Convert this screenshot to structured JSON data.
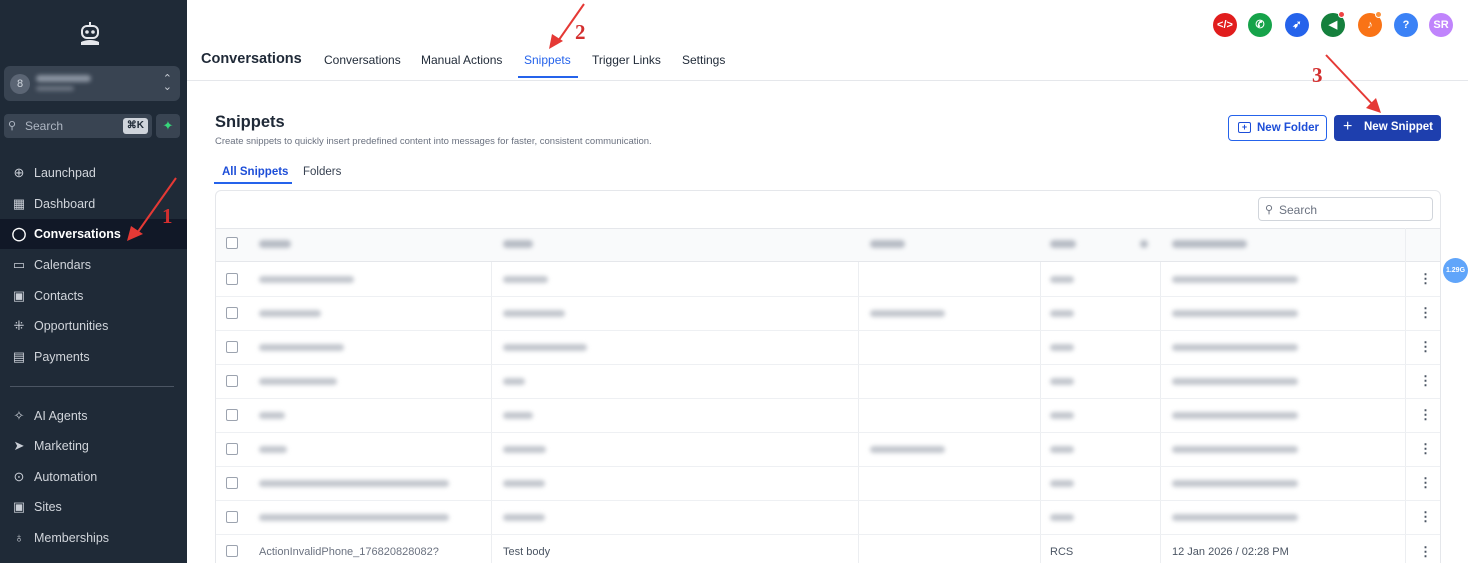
{
  "sidebar": {
    "search_placeholder": "Search",
    "search_shortcut": "⌘K",
    "account_avatar": "8",
    "items": [
      {
        "label": "Launchpad",
        "icon": "launchpad-icon",
        "glyph": "⊕",
        "active": false
      },
      {
        "label": "Dashboard",
        "icon": "dashboard-icon",
        "glyph": "▦",
        "active": false
      },
      {
        "label": "Conversations",
        "icon": "chat-bubble-icon",
        "glyph": "◯",
        "active": true
      },
      {
        "label": "Calendars",
        "icon": "calendar-icon",
        "glyph": "▭",
        "active": false
      },
      {
        "label": "Contacts",
        "icon": "contacts-icon",
        "glyph": "▣",
        "active": false
      },
      {
        "label": "Opportunities",
        "icon": "opportunities-icon",
        "glyph": "⁜",
        "active": false
      },
      {
        "label": "Payments",
        "icon": "payments-icon",
        "glyph": "▤",
        "active": false
      },
      {
        "label": "AI Agents",
        "icon": "ai-agents-icon",
        "glyph": "✧",
        "active": false
      },
      {
        "label": "Marketing",
        "icon": "marketing-icon",
        "glyph": "➤",
        "active": false
      },
      {
        "label": "Automation",
        "icon": "automation-icon",
        "glyph": "⊙",
        "active": false
      },
      {
        "label": "Sites",
        "icon": "sites-icon",
        "glyph": "▣",
        "active": false
      },
      {
        "label": "Memberships",
        "icon": "memberships-icon",
        "glyph": "♁",
        "active": false
      }
    ]
  },
  "header": {
    "title": "Conversations",
    "tabs": [
      "Conversations",
      "Manual Actions",
      "Snippets",
      "Trigger Links",
      "Settings"
    ],
    "active_tab": "Snippets",
    "avatar_initials": "SR",
    "icon_colors": {
      "code": "#e11d1d",
      "phone": "#16a34a",
      "rocket": "#2563eb",
      "megaphone": "#15803d",
      "bell": "#f97316",
      "help": "#3b82f6",
      "avatar": "#c084fc"
    }
  },
  "main": {
    "title": "Snippets",
    "subtitle": "Create snippets to quickly insert predefined content into messages for faster, consistent communication.",
    "new_folder_label": "New Folder",
    "new_snippet_label": "New Snippet",
    "subtabs": [
      "All Snippets",
      "Folders"
    ],
    "search_placeholder": "Search",
    "last_row": {
      "name": "ActionInvalidPhone_176820828082?",
      "body": "Test body",
      "type": "RCS",
      "date": "12 Jan 2026 / 02:28 PM"
    }
  },
  "badge": "1.29G",
  "annotations": [
    "1",
    "2",
    "3"
  ]
}
